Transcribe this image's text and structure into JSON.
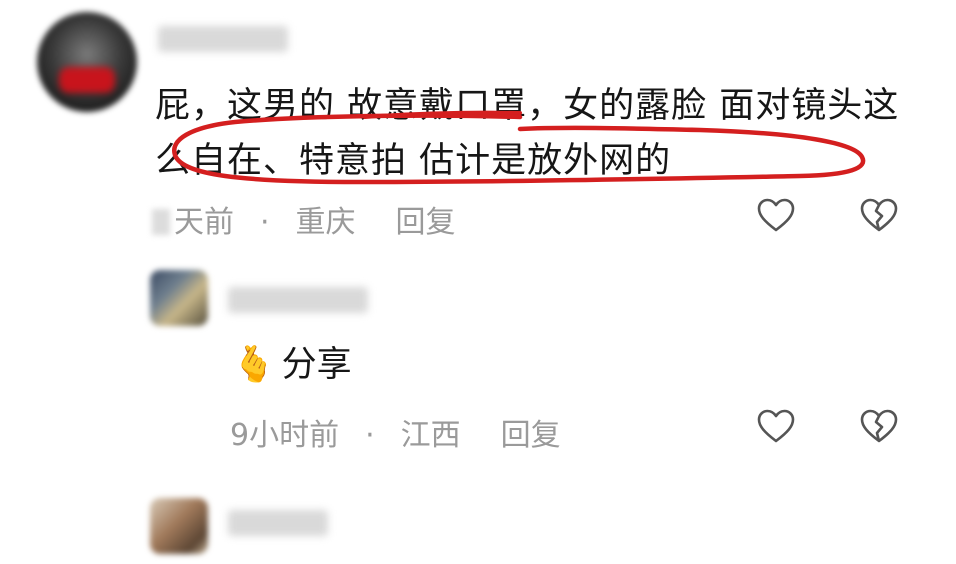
{
  "comment": {
    "text": "屁，这男的 故意戴口罩，女的露脸 面对镜头这么自在、特意拍 估计是放外网的",
    "time": "天前",
    "separator": "·",
    "location": "重庆",
    "reply_label": "回复"
  },
  "reply": {
    "emoji": "🫰",
    "text": "分享",
    "time": "9小时前",
    "separator": "·",
    "location": "江西",
    "reply_label": "回复"
  },
  "icons": {
    "like": "heart-outline-icon",
    "dislike": "broken-heart-icon"
  },
  "colors": {
    "text": "#161616",
    "meta": "#9a9a9a",
    "annotation": "#d41f1f"
  }
}
